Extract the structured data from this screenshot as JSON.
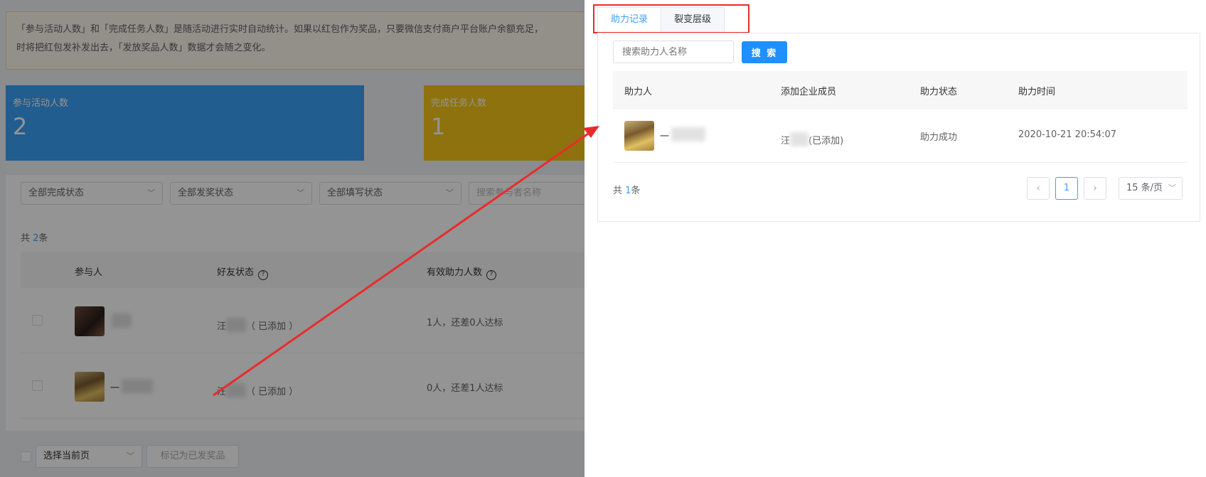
{
  "background": {
    "notice_line1": "「参与活动人数」和「完成任务人数」是随活动进行实时自动统计。如果以红包作为奖品，只要微信支付商户平台账户余额充足，",
    "notice_line2": "时将把红包发补发出去，「发放奖品人数」数据才会随之变化。",
    "stats": [
      {
        "label": "参与活动人数",
        "value": "2"
      },
      {
        "label": "完成任务人数",
        "value": "1"
      }
    ],
    "filters": {
      "complete": "全部完成状态",
      "prize": "全部发奖状态",
      "fill": "全部填写状态",
      "search_placeholder": "搜索参与者名称"
    },
    "total_prefix": "共 ",
    "total_count": "2",
    "total_suffix": "条",
    "columns": [
      "参与人",
      "好友状态",
      "有效助力人数"
    ],
    "rows": [
      {
        "name": "",
        "friend": "汪",
        "friend_suffix": "（ 已添加 ）",
        "helpers": "1人，还差0人达标"
      },
      {
        "name": "一",
        "friend": "汪",
        "friend_suffix": "（ 已添加 ）",
        "helpers": "0人，还差1人达标"
      }
    ],
    "bottom": {
      "select_label": "选择当前页",
      "mark_button": "标记为已发奖品"
    }
  },
  "drawer": {
    "tabs": [
      {
        "label": "助力记录",
        "active": true
      },
      {
        "label": "裂变层级",
        "active": false
      }
    ],
    "search_placeholder": "搜索助力人名称",
    "search_button": "搜 索",
    "columns": [
      "助力人",
      "添加企业成员",
      "助力状态",
      "助力时间"
    ],
    "rows": [
      {
        "name": "一",
        "member": "汪",
        "member_suffix": "(已添加)",
        "status": "助力成功",
        "time": "2020-10-21 20:54:07"
      }
    ],
    "total_prefix": "共 ",
    "total_count": "1",
    "total_suffix": "条",
    "pagination": {
      "prev_icon": "‹",
      "current_page": "1",
      "next_icon": "›",
      "page_size": "15 条/页"
    }
  },
  "colors": {
    "accent": "#409eff",
    "primary_button": "#1e90ff",
    "stat_blue": "#3aa0f5",
    "stat_yellow": "#f5c518",
    "annotation_red": "#e82c2c"
  }
}
